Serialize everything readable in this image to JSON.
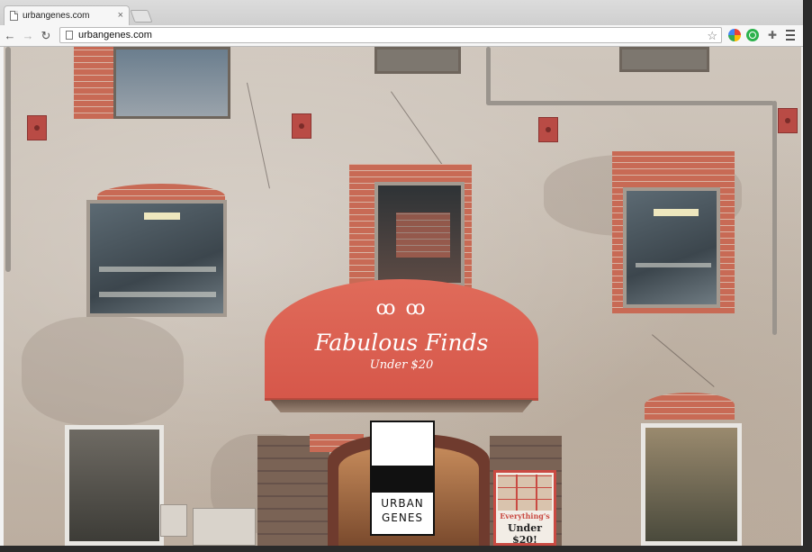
{
  "browser": {
    "tab": {
      "title": "urbangenes.com",
      "close_glyph": "×"
    },
    "toolbar": {
      "back_glyph": "←",
      "forward_glyph": "→",
      "reload_glyph": "↻",
      "url": "urbangenes.com",
      "star_glyph": "☆",
      "puzzle_glyph": "✚"
    },
    "icons": [
      "page-icon",
      "back-icon",
      "forward-icon",
      "reload-icon",
      "star-icon",
      "chrome-extension-icon",
      "green-extension-icon",
      "puzzle-extension-icon",
      "menu-icon"
    ]
  },
  "page": {
    "awning": {
      "flourish": "ꝏ ꝏ",
      "headline": "Fabulous Finds",
      "subline": "Under $20"
    },
    "logo": {
      "line1": "URBAN",
      "line2": "GENES"
    },
    "poster": {
      "line1": "Everything's",
      "line2": "Under $20!"
    },
    "colors": {
      "awning": "#d6574a",
      "brick": "#c86a55",
      "wall": "#c9bfb4"
    }
  }
}
